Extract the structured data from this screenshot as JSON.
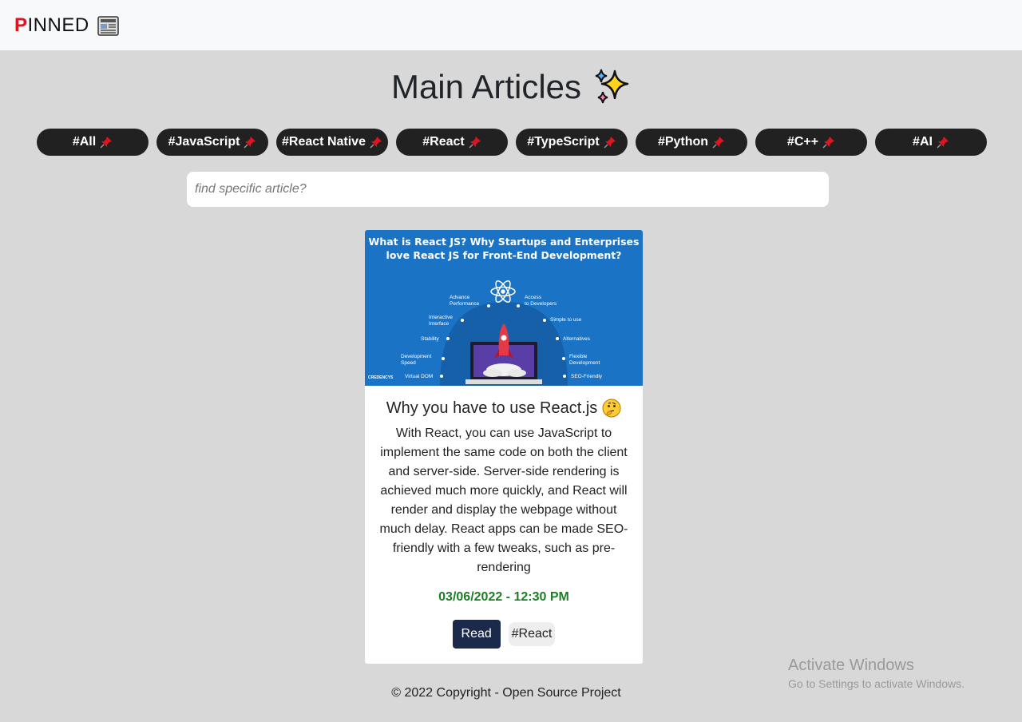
{
  "brand": {
    "first": "P",
    "rest": "INNED"
  },
  "header": {
    "title": "Main Articles"
  },
  "tags": [
    {
      "label": "#All"
    },
    {
      "label": "#JavaScript"
    },
    {
      "label": "#React Native"
    },
    {
      "label": "#React"
    },
    {
      "label": "#TypeScript"
    },
    {
      "label": "#Python"
    },
    {
      "label": "#C++"
    },
    {
      "label": "#AI"
    }
  ],
  "search": {
    "placeholder": "find specific article?"
  },
  "article": {
    "image_title_line1": "What is React JS? Why Startups and Enterprises",
    "image_title_line2": "love React JS for Front-End Development?",
    "image_labels": [
      "Advance Performance",
      "Access to Developers",
      "Interactive Interface",
      "Simple to use",
      "Stability",
      "Alternatives",
      "Development Speed",
      "Flexible Development",
      "Virtual DOM",
      "SEO-Friendly",
      "CREDENCYS"
    ],
    "title": "Why you have to use React.js",
    "text": "With React, you can use JavaScript to implement the same code on both the client and server-side. Server-side rendering is achieved much more quickly, and React will render and display the webpage without much delay. React apps can be made SEO-friendly with a few tweaks, such as pre-rendering",
    "date": "03/06/2022 - 12:30 PM",
    "read_label": "Read",
    "tag": "#React"
  },
  "footer": {
    "text": "© 2022 Copyright - Open Source Project"
  },
  "watermark": {
    "line1": "Activate Windows",
    "line2": "Go to Settings to activate Windows."
  },
  "colors": {
    "accent_red": "#e0141e",
    "tag_bg": "#212121",
    "date_green": "#1e7e24",
    "read_btn": "#1b2a4a",
    "background": "#d8d8d8"
  }
}
